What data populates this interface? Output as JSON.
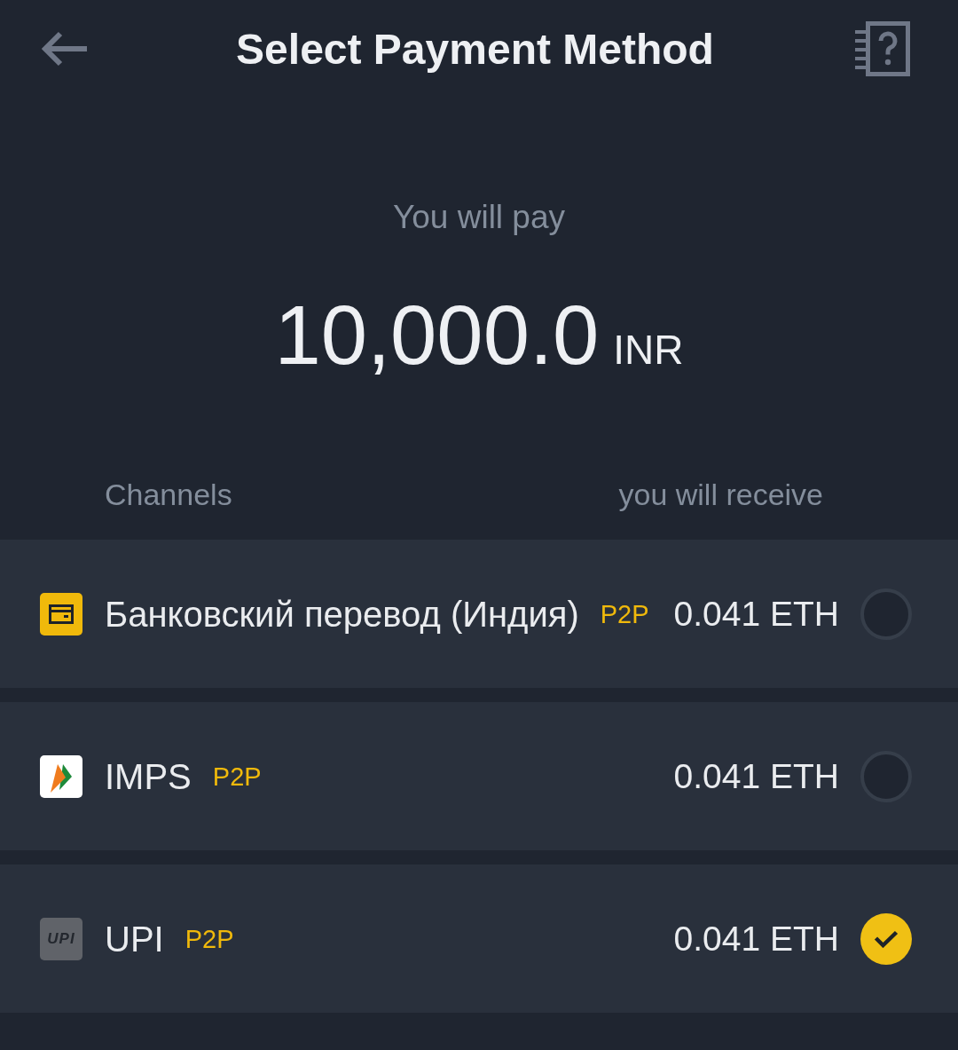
{
  "header": {
    "title": "Select Payment Method"
  },
  "payment": {
    "label": "You will pay",
    "amount": "10,000.0",
    "currency": "INR"
  },
  "columns": {
    "channels": "Channels",
    "receive": "you will receive"
  },
  "channels": [
    {
      "kind": "bank",
      "name": "Банковский перевод (Индия)",
      "tag": "P2P",
      "receive": "0.041 ETH",
      "selected": false
    },
    {
      "kind": "imps",
      "name": "IMPS",
      "tag": "P2P",
      "receive": "0.041 ETH",
      "selected": false
    },
    {
      "kind": "upi",
      "logo_text": "UPI",
      "name": "UPI",
      "tag": "P2P",
      "receive": "0.041 ETH",
      "selected": true
    }
  ]
}
